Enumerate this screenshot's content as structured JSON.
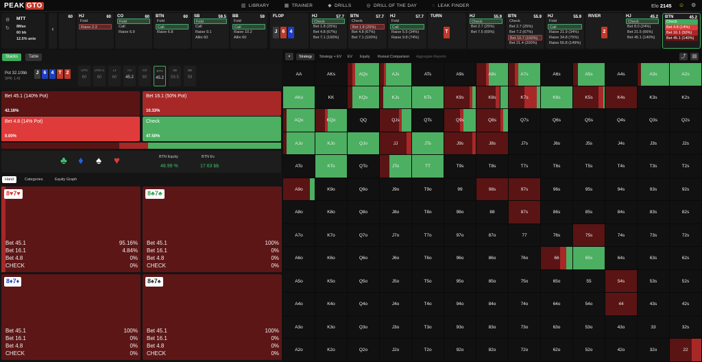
{
  "app": {
    "logo_a": "PEAK",
    "logo_b": "GTO",
    "elo_label": "Elo",
    "elo_value": "2145"
  },
  "nav": [
    {
      "label": "LIBRARY",
      "icon": "book-icon"
    },
    {
      "label": "TRAINER",
      "icon": "trainer-icon"
    },
    {
      "label": "DRILLS",
      "icon": "drills-icon"
    },
    {
      "label": "DRILL OF THE DAY",
      "icon": "calendar-icon"
    },
    {
      "label": "LEAK FINDER",
      "icon": "search-icon"
    }
  ],
  "mtt": {
    "title": "MTT",
    "max": "8Max",
    "bb": "60 bb",
    "ante": "12.5% ante"
  },
  "seats": [
    {
      "pos": "",
      "stack": "60",
      "opts": []
    },
    {
      "pos": "HJ",
      "stack": "60",
      "opts": [
        "Fold",
        "Raise 2.3"
      ],
      "sel": 1,
      "selc": "r"
    },
    {
      "pos": "CO",
      "stack": "60",
      "opts": [
        "Fold",
        "Call",
        "Raise 6.9"
      ],
      "sel": 0,
      "selc": "g"
    },
    {
      "pos": "BTN",
      "stack": "60",
      "opts": [
        "Fold",
        "Call",
        "Raise 6.8"
      ],
      "sel": 1,
      "selc": "g"
    },
    {
      "pos": "SB",
      "stack": "59.5",
      "opts": [
        "Fold",
        "Call",
        "Raise 9.1",
        "Allin 60"
      ],
      "sel": 0,
      "selc": "g"
    },
    {
      "pos": "BB",
      "stack": "59",
      "opts": [
        "Fold",
        "Call",
        "Raise 10.2",
        "Allin 60"
      ],
      "sel": 1,
      "selc": "g"
    }
  ],
  "flop": {
    "label": "FLOP",
    "cards": [
      {
        "r": "J",
        "c": "#3a3a3a"
      },
      {
        "r": "6",
        "c": "#c0392b"
      },
      {
        "r": "4",
        "c": "#1d3fbf"
      }
    ]
  },
  "flop_seats": [
    {
      "pos": "HJ",
      "stack": "57.7",
      "opts": [
        "Check",
        "Bet 1.8 (25%)",
        "Bet 4.8 (67%)",
        "Bet 7.1 (100%)"
      ],
      "sel": 0,
      "selc": "g"
    },
    {
      "pos": "BTN",
      "stack": "57.7",
      "opts": [
        "Check",
        "Bet 1.8 (25%)",
        "Bet 4.8 (67%)",
        "Bet 7.1 (100%)"
      ],
      "sel": 1,
      "selc": "r"
    },
    {
      "pos": "HJ",
      "stack": "57.7",
      "opts": [
        "Fold",
        "Call",
        "Raise 5.5 (34%)",
        "Raise 9.8 (74%)"
      ],
      "sel": 1,
      "selc": "g"
    }
  ],
  "turn": {
    "label": "TURN",
    "cards": [
      {
        "r": "T",
        "c": "#c0392b"
      }
    ]
  },
  "turn_seats": [
    {
      "pos": "HJ",
      "stack": "55.9",
      "opts": [
        "Check",
        "Bet 2.7 (25%)",
        "Bet 7.5 (69%)"
      ],
      "sel": 0,
      "selc": "g"
    },
    {
      "pos": "BTN",
      "stack": "55.9",
      "opts": [
        "Check",
        "Bet 2.7 (25%)",
        "Bet 7.2 (67%)",
        "Bet 10.7 (100%)",
        "Bet 21.4 (200%)"
      ],
      "sel": 3,
      "selc": "r"
    },
    {
      "pos": "HJ",
      "stack": "55.9",
      "opts": [
        "Fold",
        "Call",
        "Raise 21.9 (34%)",
        "Raise 34.8 (75%)",
        "Raise 55.8 (149%)"
      ],
      "sel": 1,
      "selc": "g"
    }
  ],
  "river": {
    "label": "RIVER",
    "cards": [
      {
        "r": "2",
        "c": "#c0392b"
      }
    ]
  },
  "river_seats": [
    {
      "pos": "HJ",
      "stack": "45.2",
      "opts": [
        "Check",
        "Bet 8.0 (24%)",
        "Bet 21.5 (66%)",
        "Bet 45.1 (140%)"
      ],
      "sel": 0,
      "selc": "g"
    },
    {
      "pos": "BTN",
      "stack": "45.2",
      "opts": [
        "Check",
        "Bet 4.8 (14%)",
        "Bet 16.1 (50%)",
        "Bet 45.1 (140%)"
      ],
      "sel": 0,
      "selc": "active"
    }
  ],
  "left": {
    "tab_stacks": "Stacks",
    "tab_table": "Table",
    "pot": "Pot  32.10bb",
    "spr": "SPR: 1.41",
    "board": [
      {
        "r": "J",
        "c": "#3a3a3a"
      },
      {
        "r": "6",
        "c": "#1d3fbf"
      },
      {
        "r": "4",
        "c": "#1d3fbf"
      },
      {
        "r": "T",
        "c": "#c0392b"
      },
      {
        "r": "2",
        "c": "#c0392b"
      }
    ],
    "minis": [
      {
        "a": "UTG",
        "b": "60"
      },
      {
        "a": "UTG+1",
        "b": "60"
      },
      {
        "a": "LJ",
        "b": "60"
      },
      {
        "a": "HJ",
        "b": "45.2"
      },
      {
        "a": "CO",
        "b": "60"
      },
      {
        "a": "BTN",
        "b": "45.2"
      },
      {
        "a": "SB",
        "b": "59.5"
      },
      {
        "a": "BB",
        "b": "59"
      }
    ],
    "actions": [
      {
        "name": "Bet 45.1 (140% Pot)",
        "freq": "42.16%",
        "color": "#5a1414"
      },
      {
        "name": "Bet 16.1 (50% Pot)",
        "freq": "10.33%",
        "color": "#a82828"
      },
      {
        "name": "Bet 4.8 (14% Pot)",
        "freq": "0.00%",
        "color": "#e03b3b"
      },
      {
        "name": "Check",
        "freq": "47.50%",
        "color": "#4caf61"
      }
    ],
    "freq": [
      42.16,
      10.33,
      0,
      47.5
    ],
    "suits": [
      {
        "s": "♣",
        "c": "#3fc36b"
      },
      {
        "s": "♦",
        "c": "#2a5fe0"
      },
      {
        "s": "♠",
        "c": "#fff"
      },
      {
        "s": "♥",
        "c": "#e03b3b"
      }
    ],
    "eq_label": "BTN Equity",
    "eq_value": "48.99 %",
    "ev_label": "BTN Ev",
    "ev_value": "17.63 bb",
    "subtabs": [
      "Hand",
      "Categories",
      "Equity Graph"
    ],
    "hands": [
      {
        "cards": [
          {
            "t": "8♥",
            "c": "#d32f2f"
          },
          {
            "t": "7♥",
            "c": "#d32f2f"
          }
        ],
        "rows": [
          [
            "Bet 45.1",
            "95.16%"
          ],
          [
            "Bet 16.1",
            "4.84%"
          ],
          [
            "Bet 4.8",
            "0%"
          ],
          [
            "CHECK",
            "0%"
          ]
        ]
      },
      {
        "cards": [
          {
            "t": "8♣",
            "c": "#2e9e48"
          },
          {
            "t": "7♣",
            "c": "#2e9e48"
          }
        ],
        "rows": [
          [
            "Bet 45.1",
            "100%"
          ],
          [
            "Bet 16.1",
            "0%"
          ],
          [
            "Bet 4.8",
            "0%"
          ],
          [
            "CHECK",
            "0%"
          ]
        ]
      },
      {
        "cards": [
          {
            "t": "8♦",
            "c": "#1d3fbf"
          },
          {
            "t": "7♦",
            "c": "#1d3fbf"
          }
        ],
        "rows": [
          [
            "Bet 45.1",
            "100%"
          ],
          [
            "Bet 16.1",
            "0%"
          ],
          [
            "Bet 4.8",
            "0%"
          ],
          [
            "CHECK",
            "0%"
          ]
        ]
      },
      {
        "cards": [
          {
            "t": "8♠",
            "c": "#222"
          },
          {
            "t": "7♠",
            "c": "#222"
          }
        ],
        "rows": [
          [
            "Bet 45.1",
            "100%"
          ],
          [
            "Bet 16.1",
            "0%"
          ],
          [
            "Bet 4.8",
            "0%"
          ],
          [
            "CHECK",
            "0%"
          ]
        ]
      }
    ]
  },
  "right": {
    "tabs": [
      "Strategy",
      "Strategy + EV",
      "EV",
      "Equity",
      "Runout Comparison",
      "Aggregate Reports"
    ]
  },
  "colors": {
    "dark": "#5a1414",
    "mid": "#a82828",
    "bright": "#e03b3b",
    "check": "#4caf61"
  },
  "grid": [
    [
      "AA",
      "AKs",
      "AQs",
      "AJs",
      "ATs",
      "A9s",
      "A8s",
      "A7s",
      "A6s",
      "A5s",
      "A4s",
      "A3s",
      "A2s"
    ],
    [
      "AKo",
      "KK",
      "KQs",
      "KJs",
      "KTs",
      "K9s",
      "K8s",
      "K7s",
      "K6s",
      "K5s",
      "K4s",
      "K3s",
      "K2s"
    ],
    [
      "AQo",
      "KQo",
      "QQ",
      "QJs",
      "QTs",
      "Q9s",
      "Q8s",
      "Q7s",
      "Q6s",
      "Q5s",
      "Q4s",
      "Q3s",
      "Q2s"
    ],
    [
      "AJo",
      "KJo",
      "QJo",
      "JJ",
      "JTs",
      "J9s",
      "J8s",
      "J7s",
      "J6s",
      "J5s",
      "J4s",
      "J3s",
      "J2s"
    ],
    [
      "ATo",
      "KTo",
      "QTo",
      "JTo",
      "TT",
      "T9s",
      "T8s",
      "T7s",
      "T6s",
      "T5s",
      "T4s",
      "T3s",
      "T2s"
    ],
    [
      "A9o",
      "K9o",
      "Q9o",
      "J9o",
      "T9o",
      "99",
      "98s",
      "97s",
      "96s",
      "95s",
      "94s",
      "93s",
      "92s"
    ],
    [
      "A8o",
      "K8o",
      "Q8o",
      "J8o",
      "T8o",
      "98o",
      "88",
      "87s",
      "86s",
      "85s",
      "84s",
      "83s",
      "82s"
    ],
    [
      "A7o",
      "K7o",
      "Q7o",
      "J7o",
      "T7o",
      "97o",
      "87o",
      "77",
      "76s",
      "75s",
      "74s",
      "73s",
      "72s"
    ],
    [
      "A6o",
      "K6o",
      "Q6o",
      "J6o",
      "T6o",
      "96o",
      "86o",
      "76o",
      "66",
      "65s",
      "64s",
      "63s",
      "62s"
    ],
    [
      "A5o",
      "K5o",
      "Q5o",
      "J5o",
      "T5o",
      "95o",
      "85o",
      "75o",
      "65o",
      "55",
      "54s",
      "53s",
      "52s"
    ],
    [
      "A4o",
      "K4o",
      "Q4o",
      "J4o",
      "T4o",
      "94o",
      "84o",
      "74o",
      "64o",
      "54o",
      "44",
      "43s",
      "42s"
    ],
    [
      "A3o",
      "K3o",
      "Q3o",
      "J3o",
      "T3o",
      "93o",
      "83o",
      "73o",
      "63o",
      "53o",
      "43o",
      "33",
      "32s"
    ],
    [
      "A2o",
      "K2o",
      "Q2o",
      "J2o",
      "T2o",
      "92o",
      "82o",
      "72o",
      "62o",
      "52o",
      "42o",
      "32o",
      "22"
    ]
  ],
  "grid_mix": {
    "AQs": [
      0.15,
      0.08,
      0,
      0.77
    ],
    "AJs": [
      0.12,
      0.08,
      0,
      0.8
    ],
    "A8s": [
      0.3,
      0.1,
      0,
      0.6
    ],
    "A7s": [
      0.2,
      0.1,
      0,
      0.7
    ],
    "A5s": [
      0.15,
      0,
      0,
      0.85
    ],
    "A3s": [
      0.1,
      0,
      0,
      0.9
    ],
    "A2s": [
      0,
      0,
      0,
      1
    ],
    "AKo": [
      0,
      0,
      0,
      1
    ],
    "KQs": [
      0.15,
      0,
      0,
      0.85
    ],
    "KJs": [
      0.1,
      0,
      0,
      0.9
    ],
    "KTs": [
      0,
      0,
      0,
      1
    ],
    "K9s": [
      0.8,
      0.1,
      0,
      0.1
    ],
    "K8s": [
      0.6,
      0.15,
      0,
      0.25
    ],
    "K7s": [
      0.5,
      0.4,
      0,
      0.1
    ],
    "K6s": [
      0,
      0,
      0,
      1
    ],
    "K5s": [
      0.8,
      0.15,
      0,
      0.05
    ],
    "K4s": [
      1,
      0,
      0,
      0
    ],
    "AQo": [
      0.1,
      0,
      0,
      0.9
    ],
    "KQo": [
      0.3,
      0.1,
      0,
      0.6
    ],
    "QJs": [
      0.6,
      0.1,
      0,
      0.3
    ],
    "Q9s": [
      0.5,
      0.1,
      0,
      0.4
    ],
    "Q8s": [
      0.75,
      0.1,
      0,
      0.15
    ],
    "AJo": [
      0.1,
      0,
      0,
      0.9
    ],
    "KJo": [
      0,
      0,
      0,
      1
    ],
    "QJo": [
      0,
      0,
      0,
      1
    ],
    "JJ": [
      0.85,
      0.15,
      0,
      0
    ],
    "JTs": [
      0,
      0,
      0,
      1
    ],
    "J9s": [
      0.9,
      0.1,
      0,
      0
    ],
    "J8s": [
      1,
      0,
      0,
      0
    ],
    "KTo": [
      0,
      0,
      0,
      1
    ],
    "JTo": [
      0.3,
      0,
      0,
      0.7
    ],
    "TT": [
      0,
      0,
      0,
      1
    ],
    "A9o": [
      0.85,
      0,
      0,
      0.15
    ],
    "98s": [
      1,
      0,
      0,
      0
    ],
    "97s": [
      1,
      0,
      0,
      0
    ],
    "87s": [
      1,
      0,
      0,
      0
    ],
    "75s": [
      1,
      0,
      0,
      0
    ],
    "66": [
      0.6,
      0.2,
      0,
      0.2
    ],
    "65s": [
      0,
      0,
      0,
      1
    ],
    "54s": [
      1,
      0,
      0,
      0
    ],
    "44": [
      1,
      0,
      0,
      0
    ],
    "22": [
      0.7,
      0.3,
      0,
      0
    ]
  }
}
